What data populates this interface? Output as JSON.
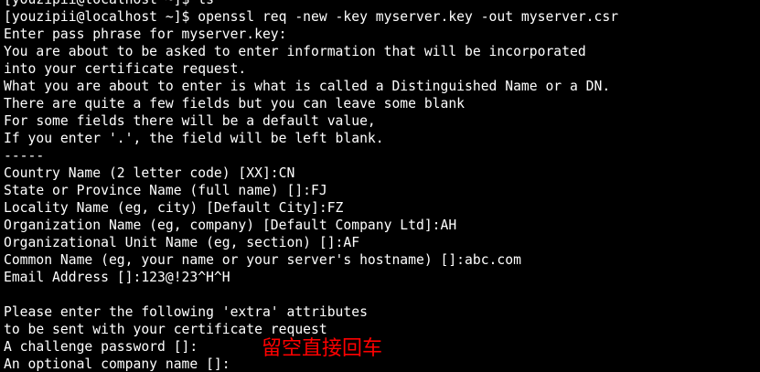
{
  "terminal": {
    "lines": [
      "[youzipii@localhost ~]$ ls",
      "[youzipii@localhost ~]$ openssl req -new -key myserver.key -out myserver.csr",
      "Enter pass phrase for myserver.key:",
      "You are about to be asked to enter information that will be incorporated",
      "into your certificate request.",
      "What you are about to enter is what is called a Distinguished Name or a DN.",
      "There are quite a few fields but you can leave some blank",
      "For some fields there will be a default value,",
      "If you enter '.', the field will be left blank.",
      "-----",
      "Country Name (2 letter code) [XX]:CN",
      "State or Province Name (full name) []:FJ",
      "Locality Name (eg, city) [Default City]:FZ",
      "Organization Name (eg, company) [Default Company Ltd]:AH",
      "Organizational Unit Name (eg, section) []:AF",
      "Common Name (eg, your name or your server's hostname) []:abc.com",
      "Email Address []:123@!23^H^H",
      "",
      "Please enter the following 'extra' attributes",
      "to be sent with your certificate request",
      "A challenge password []:",
      "An optional company name []:"
    ]
  },
  "annotation": {
    "text": "留空直接回车"
  },
  "colors": {
    "background": "#000000",
    "text": "#ffffff",
    "cursor": "#00ff00",
    "annotation": "#ff0000"
  }
}
